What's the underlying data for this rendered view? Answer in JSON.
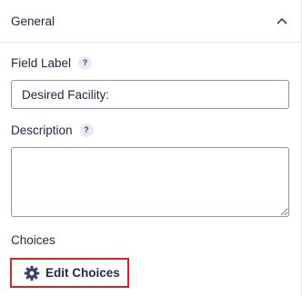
{
  "section": {
    "title": "General",
    "toggle_icon": "chevron-up-icon"
  },
  "field_label": {
    "label": "Field Label",
    "help": "?",
    "value": "Desired Facility:"
  },
  "description": {
    "label": "Description",
    "help": "?",
    "value": ""
  },
  "choices": {
    "label": "Choices",
    "button_label": "Edit Choices",
    "button_icon": "gear-icon",
    "highlight_color": "#e01f26"
  }
}
